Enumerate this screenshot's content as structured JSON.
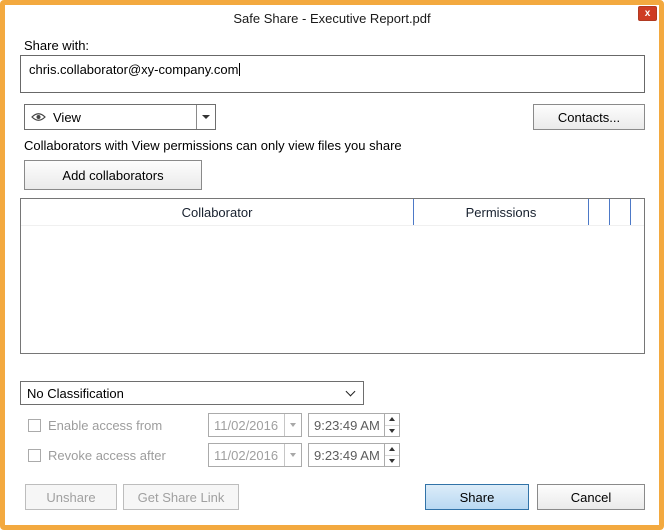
{
  "window": {
    "title": "Safe Share - Executive Report.pdf",
    "close": "x"
  },
  "share": {
    "label": "Share with:",
    "recipient": "chris.collaborator@xy-company.com"
  },
  "permissions": {
    "selected": "View",
    "hint": "Collaborators with View permissions can only view files you share"
  },
  "buttons": {
    "contacts": "Contacts...",
    "add_collaborators": "Add collaborators",
    "unshare": "Unshare",
    "get_share_link": "Get Share Link",
    "share": "Share",
    "cancel": "Cancel"
  },
  "collaborator_table": {
    "headers": [
      "Collaborator",
      "Permissions"
    ],
    "rows": []
  },
  "classification": {
    "selected": "No Classification"
  },
  "access_control": {
    "enable_from": {
      "label": "Enable access from",
      "date": "11/02/2016",
      "time": "9:23:49 AM"
    },
    "revoke_after": {
      "label": "Revoke access after",
      "date": "11/02/2016",
      "time": "9:23:49 AM"
    }
  },
  "colors": {
    "frame_orange": "#f3a93f",
    "close_red": "#ce3c23",
    "table_separator_blue": "#4d79c7",
    "share_button_border": "#3173a8",
    "share_button_fill": "#b9d9f2"
  }
}
